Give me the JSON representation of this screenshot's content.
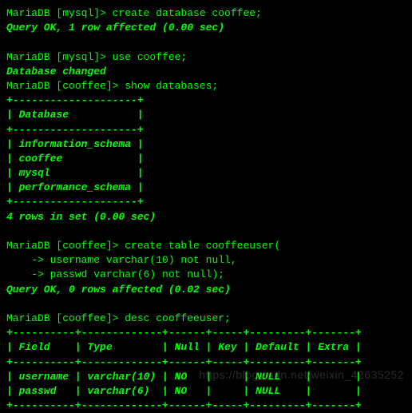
{
  "lines": [
    {
      "cls": "normal",
      "text": "MariaDB [mysql]> create database cooffee;"
    },
    {
      "cls": "bold",
      "text": "Query OK, 1 row affected (0.00 sec)"
    },
    {
      "cls": "normal",
      "text": ""
    },
    {
      "cls": "normal",
      "text": "MariaDB [mysql]> use cooffee;"
    },
    {
      "cls": "bold",
      "text": "Database changed"
    },
    {
      "cls": "normal",
      "text": "MariaDB [cooffee]> show databases;"
    },
    {
      "cls": "bold",
      "text": "+--------------------+"
    },
    {
      "cls": "bold",
      "text": "| Database           |"
    },
    {
      "cls": "bold",
      "text": "+--------------------+"
    },
    {
      "cls": "bold",
      "text": "| information_schema |"
    },
    {
      "cls": "bold",
      "text": "| cooffee            |"
    },
    {
      "cls": "bold",
      "text": "| mysql              |"
    },
    {
      "cls": "bold",
      "text": "| performance_schema |"
    },
    {
      "cls": "bold",
      "text": "+--------------------+"
    },
    {
      "cls": "bold",
      "text": "4 rows in set (0.00 sec)"
    },
    {
      "cls": "normal",
      "text": ""
    },
    {
      "cls": "normal",
      "text": "MariaDB [cooffee]> create table cooffeeuser("
    },
    {
      "cls": "normal",
      "text": "    -> username varchar(10) not null,"
    },
    {
      "cls": "normal",
      "text": "    -> passwd varchar(6) not null);"
    },
    {
      "cls": "bold",
      "text": "Query OK, 0 rows affected (0.02 sec)"
    },
    {
      "cls": "normal",
      "text": ""
    },
    {
      "cls": "normal",
      "text": "MariaDB [cooffee]> desc cooffeeuser;"
    },
    {
      "cls": "bold",
      "text": "+----------+-------------+------+-----+---------+-------+"
    },
    {
      "cls": "bold",
      "text": "| Field    | Type        | Null | Key | Default | Extra |"
    },
    {
      "cls": "bold",
      "text": "+----------+-------------+------+-----+---------+-------+"
    },
    {
      "cls": "bold",
      "text": "| username | varchar(10) | NO   |     | NULL    |       |"
    },
    {
      "cls": "bold",
      "text": "| passwd   | varchar(6)  | NO   |     | NULL    |       |"
    },
    {
      "cls": "bold",
      "text": "+----------+-------------+------+-----+---------+-------+"
    }
  ],
  "watermark": "https://blog.csdn.net/weixin_42635252"
}
